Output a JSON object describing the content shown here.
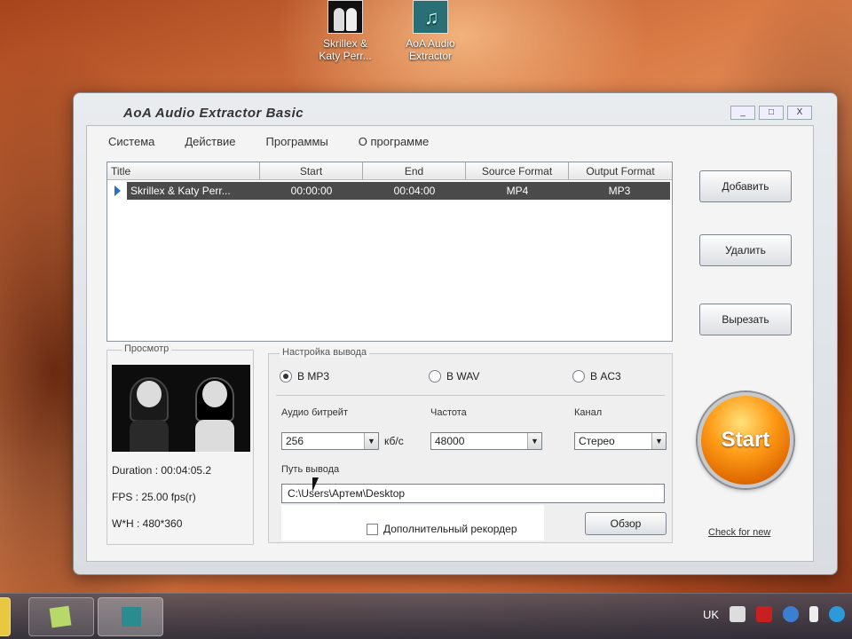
{
  "desktop": {
    "icons": [
      {
        "label_line1": "Skrillex &",
        "label_line2": "Katy Perr..."
      },
      {
        "label_line1": "AoA Audio",
        "label_line2": "Extractor"
      }
    ]
  },
  "window": {
    "title": "AoA Audio Extractor Basic",
    "buttons": {
      "minimize": "_",
      "maximize": "□",
      "close": "X"
    },
    "menu": [
      "Система",
      "Действие",
      "Программы",
      "О программе"
    ]
  },
  "grid": {
    "columns": [
      "Title",
      "Start",
      "End",
      "Source Format",
      "Output Format"
    ],
    "rows": [
      {
        "title": "Skrillex & Katy Perr...",
        "start": "00:00:00",
        "end": "00:04:00",
        "source": "MP4",
        "output": "MP3"
      }
    ]
  },
  "side_buttons": {
    "add": "Добавить",
    "remove": "Удалить",
    "cut": "Вырезать"
  },
  "preview": {
    "legend": "Просмотр",
    "duration": "Duration : 00:04:05.2",
    "fps": "FPS : 25.00 fps(r)",
    "size": "W*H : 480*360"
  },
  "settings": {
    "legend": "Настройка вывода",
    "formats": [
      {
        "label": "В MP3",
        "selected": true
      },
      {
        "label": "В WAV",
        "selected": false
      },
      {
        "label": "В AC3",
        "selected": false
      }
    ],
    "bitrate_label": "Аудио битрейт",
    "bitrate_value": "256",
    "bitrate_unit": "кб/с",
    "freq_label": "Частота",
    "freq_value": "48000",
    "channel_label": "Канал",
    "channel_value": "Стерео",
    "path_label": "Путь вывода",
    "path_value": "C:\\Users\\Артем\\Desktop",
    "advanced_label": "Дополнительный рекордер",
    "browse_label": "Обзор"
  },
  "start_label": "Start",
  "link_label": "Check for new",
  "tray": {
    "lang": "UK"
  }
}
